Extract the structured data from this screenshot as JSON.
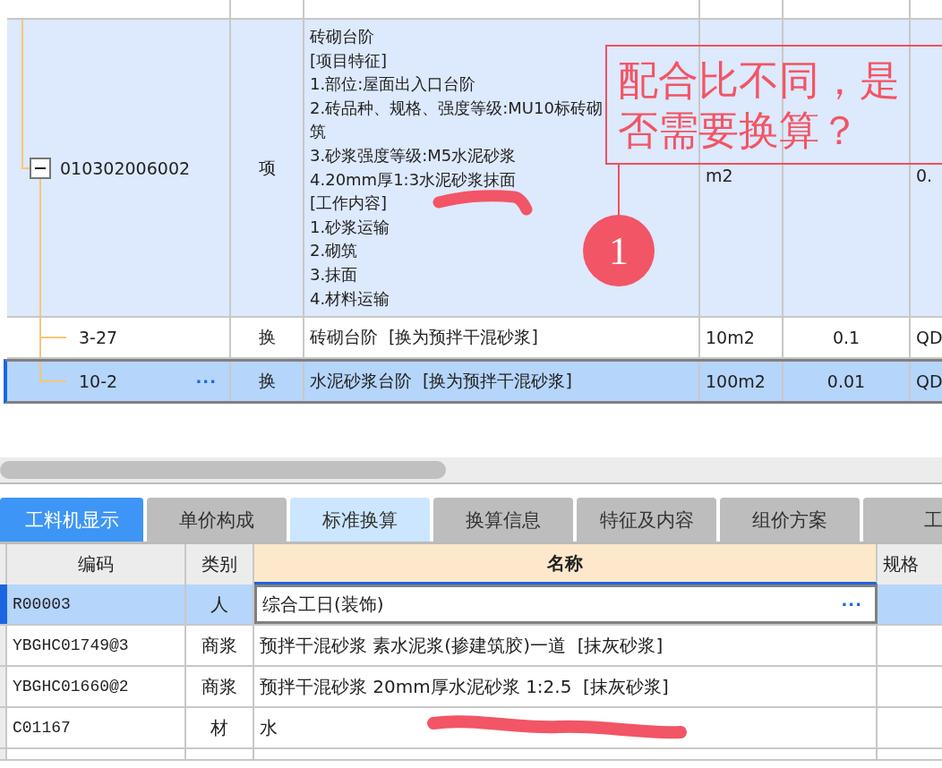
{
  "top_table": {
    "rows": [
      {
        "kind": "item",
        "code": "010302006002",
        "expanded": true,
        "type": "项",
        "description": [
          "砖砌台阶",
          "[项目特征]",
          "1.部位:屋面出入口台阶",
          "2.砖品种、规格、强度等级:MU10标砖砌筑",
          "3.砂浆强度等级:M5水泥砂浆",
          "4.20mm厚1:3水泥砂浆抹面",
          "[工作内容]",
          "1.砂浆运输",
          "2.砌筑",
          "3.抹面",
          "4.材料运输"
        ],
        "unit": "m2",
        "quantity": "",
        "column_6": "0.",
        "selected": false
      },
      {
        "kind": "sub",
        "code": "3-27",
        "type": "换",
        "description": [
          "砖砌台阶  [换为预拌干混砂浆]"
        ],
        "unit": "10m2",
        "quantity": "0.1",
        "column_6": "QD",
        "selected": false
      },
      {
        "kind": "sub",
        "code": "10-2",
        "more": "···",
        "type": "换",
        "description": [
          "水泥砂浆台阶  [换为预拌干混砂浆]"
        ],
        "unit": "100m2",
        "quantity": "0.01",
        "column_6": "QD",
        "selected": true
      }
    ]
  },
  "annotation": {
    "callout": "配合比不同，是否需要换算？",
    "marker": "1"
  },
  "tabs": [
    {
      "label": "工料机显示",
      "selected": true,
      "highlighted": false
    },
    {
      "label": "单价构成",
      "selected": false,
      "highlighted": false
    },
    {
      "label": "标准换算",
      "selected": false,
      "highlighted": true
    },
    {
      "label": "换算信息",
      "selected": false,
      "highlighted": false
    },
    {
      "label": "特征及内容",
      "selected": false,
      "highlighted": false
    },
    {
      "label": "组价方案",
      "selected": false,
      "highlighted": false
    },
    {
      "label": "工",
      "selected": false,
      "highlighted": false
    }
  ],
  "resource_table": {
    "columns": [
      "编码",
      "类别",
      "名称",
      "规格"
    ],
    "rows": [
      {
        "code": "R00003",
        "category": "人",
        "name": "综合工日(装饰)",
        "more": "···",
        "selected": true
      },
      {
        "code": "YBGHC01749@3",
        "category": "商浆",
        "name": "预拌干混砂浆 素水泥浆(掺建筑胶)一道  [抹灰砂浆]",
        "selected": false
      },
      {
        "code": "YBGHC01660@2",
        "category": "商浆",
        "name": "预拌干混砂浆 20mm厚水泥砂浆 1:2.5  [抹灰砂浆]",
        "selected": false
      },
      {
        "code": "C01167",
        "category": "材",
        "name": "水",
        "selected": false
      }
    ]
  }
}
